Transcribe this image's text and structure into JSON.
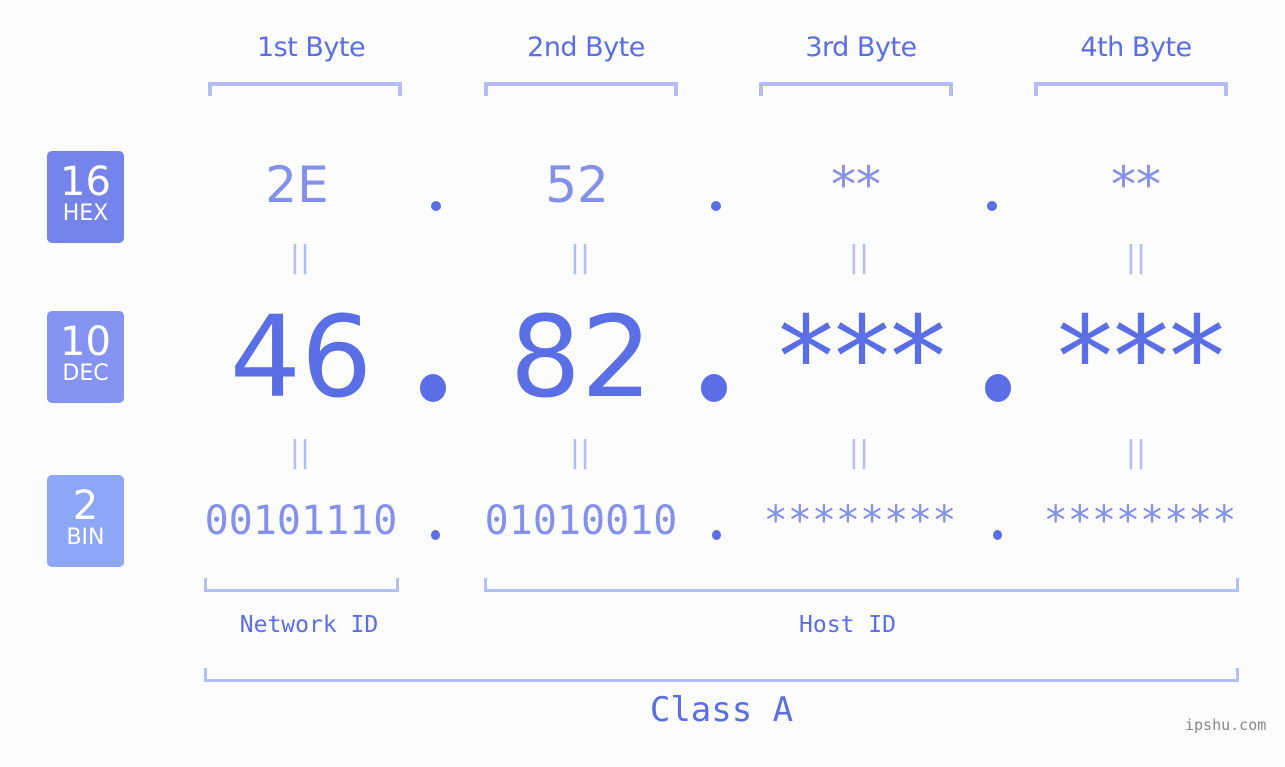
{
  "headers": [
    "1st Byte",
    "2nd Byte",
    "3rd Byte",
    "4th Byte"
  ],
  "badges": {
    "hex": {
      "num": "16",
      "label": "HEX",
      "color": "#7584ea"
    },
    "dec": {
      "num": "10",
      "label": "DEC",
      "color": "#8594f0"
    },
    "bin": {
      "num": "2",
      "label": "BIN",
      "color": "#8ea6f6"
    }
  },
  "hex": [
    "2E",
    "52",
    "**",
    "**"
  ],
  "dec": [
    "46",
    "82",
    "***",
    "***"
  ],
  "bin": [
    "00101110",
    "01010010",
    "********",
    "********"
  ],
  "equals_glyph": "||",
  "network_label": "Network ID",
  "host_label": "Host ID",
  "class_label": "Class A",
  "watermark": "ipshu.com",
  "colors": {
    "accent": "#5a6ee6",
    "light": "#8390ec",
    "bracket": "#b3bdf7"
  }
}
